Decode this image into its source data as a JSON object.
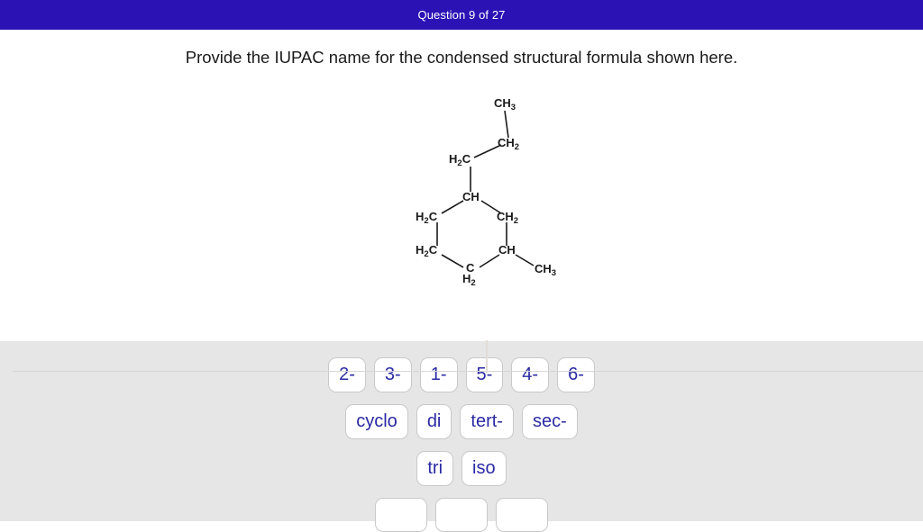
{
  "header": {
    "title": "Question 9 of 27",
    "background_color": "#2b12b5",
    "text_color": "#ffffff"
  },
  "question": {
    "prompt": "Provide the IUPAC name for the condensed structural formula shown here."
  },
  "structure": {
    "description": "Condensed structural formula: cyclohexane ring with a propyl group and a methyl group",
    "atoms": [
      {
        "id": "chain-ch3",
        "label": "CH",
        "sub": "3"
      },
      {
        "id": "chain-ch2",
        "label": "CH",
        "sub": "2"
      },
      {
        "id": "chain-h2c",
        "label": "H",
        "sub": "2",
        "label_tail": "C"
      },
      {
        "id": "ring-top-ch",
        "label": "CH",
        "sub": ""
      },
      {
        "id": "ring-upper-left-h2c",
        "label": "H",
        "sub": "2",
        "label_tail": "C"
      },
      {
        "id": "ring-upper-right-ch2",
        "label": "CH",
        "sub": "2"
      },
      {
        "id": "ring-lower-left-h2c",
        "label": "H",
        "sub": "2",
        "label_tail": "C"
      },
      {
        "id": "ring-lower-right-ch",
        "label": "CH",
        "sub": ""
      },
      {
        "id": "ring-bottom-c",
        "label": "C",
        "sub": ""
      },
      {
        "id": "ring-bottom-h2",
        "label": "H",
        "sub": "2"
      },
      {
        "id": "methyl-ch3",
        "label": "CH",
        "sub": "3"
      }
    ]
  },
  "answer_entry": {
    "value": "",
    "caret_visible": true
  },
  "token_bank": {
    "background_color": "#e6e6e6",
    "token_text_color": "#2a2aa5",
    "rows": [
      {
        "tokens": [
          "2-",
          "3-",
          "1-",
          "5-",
          "4-",
          "6-"
        ],
        "clipped": false
      },
      {
        "tokens": [
          "cyclo",
          "di",
          "tert-",
          "sec-"
        ],
        "clipped": false
      },
      {
        "tokens": [
          "tri",
          "iso"
        ],
        "clipped": false
      },
      {
        "tokens": [
          "",
          "",
          ""
        ],
        "clipped": true
      }
    ]
  }
}
